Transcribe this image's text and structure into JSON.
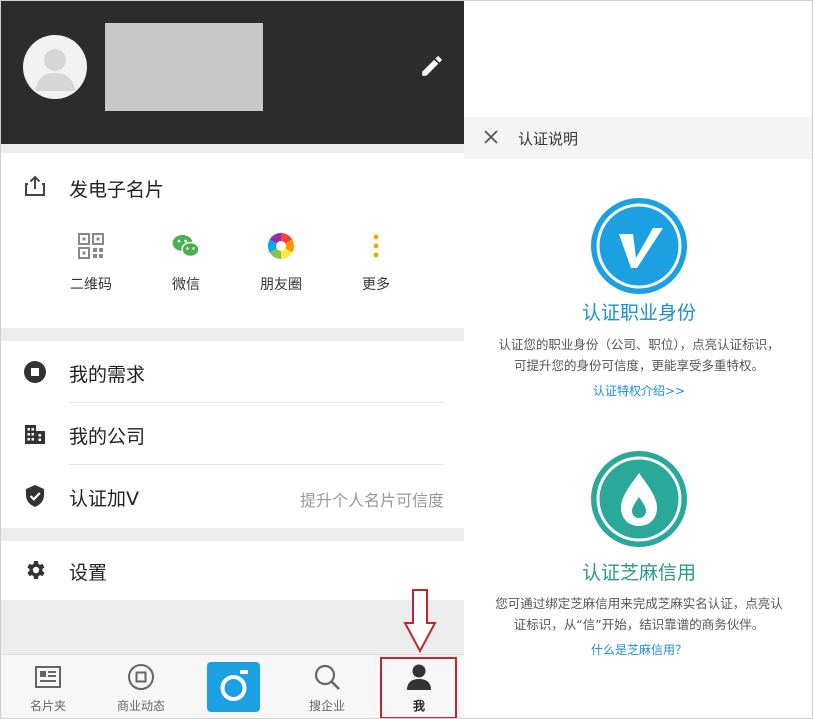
{
  "profile": {
    "edit_icon": "pencil-icon"
  },
  "share": {
    "title": "发电子名片",
    "items": [
      {
        "label": "二维码",
        "icon": "qr-code-icon"
      },
      {
        "label": "微信",
        "icon": "wechat-icon"
      },
      {
        "label": "朋友圈",
        "icon": "moments-icon"
      },
      {
        "label": "更多",
        "icon": "more-vertical-icon"
      }
    ]
  },
  "menu": {
    "items": [
      {
        "label": "我的需求",
        "icon": "stop-circle-icon",
        "hint": ""
      },
      {
        "label": "我的公司",
        "icon": "building-icon",
        "hint": ""
      },
      {
        "label": "认证加V",
        "icon": "shield-check-icon",
        "hint": "提升个人名片可信度"
      }
    ],
    "settings": {
      "label": "设置",
      "icon": "gear-icon"
    }
  },
  "tabbar": {
    "tabs": [
      {
        "label": "名片夹",
        "icon": "card-holder-icon"
      },
      {
        "label": "商业动态",
        "icon": "business-news-icon"
      },
      {
        "label": "",
        "icon": "camera-icon"
      },
      {
        "label": "搜企业",
        "icon": "search-icon"
      },
      {
        "label": "我",
        "icon": "person-icon",
        "active": true
      }
    ]
  },
  "verify": {
    "title": "认证说明",
    "job": {
      "title": "认证职业身份",
      "desc_line1": "认证您的职业身份（公司、职位），点亮认证标识，",
      "desc_line2": "可提升您的身份可信度，更能享受多重特权。",
      "link": "认证特权介绍>>"
    },
    "sesame": {
      "title": "认证芝麻信用",
      "desc_line1": "您可通过绑定芝麻信用来完成芝麻实名认证，点亮认",
      "desc_line2": "证标识，从“信”开始，结识靠谱的商务伙伴。",
      "link": "什么是芝麻信用？"
    }
  },
  "colors": {
    "header_bg": "#2c2c2c",
    "accent_blue": "#1ba1e2",
    "sesame_green": "#2a9a8a",
    "annotation_red": "#c0272d"
  }
}
